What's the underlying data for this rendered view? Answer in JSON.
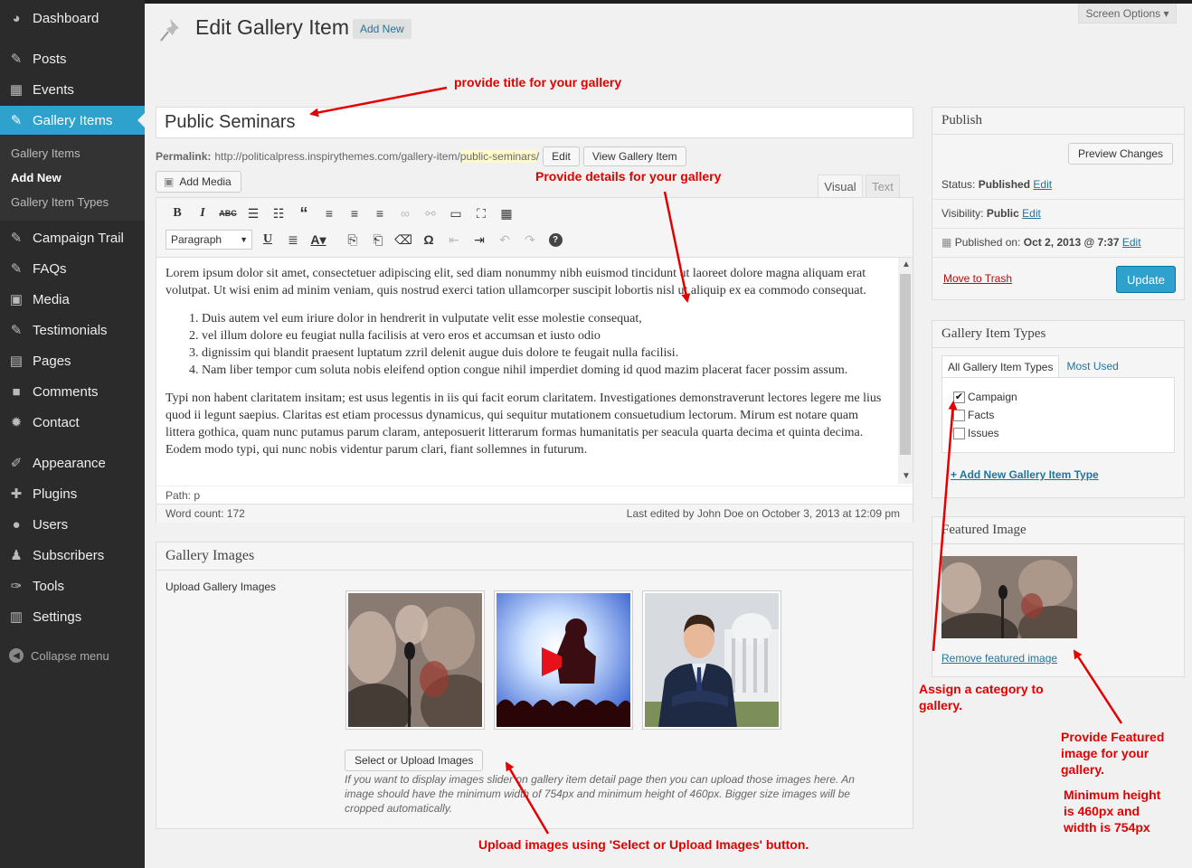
{
  "sidebar": {
    "items": [
      {
        "label": "Dashboard",
        "icon": "dashboard-icon",
        "glyph": "◕"
      },
      {
        "label": "Posts",
        "icon": "pin-icon",
        "glyph": "✎"
      },
      {
        "label": "Events",
        "icon": "calendar-icon",
        "glyph": "▦"
      },
      {
        "label": "Gallery Items",
        "icon": "pin-icon",
        "glyph": "✎"
      },
      {
        "label": "Campaign Trail",
        "icon": "pin-icon",
        "glyph": "✎"
      },
      {
        "label": "FAQs",
        "icon": "pin-icon",
        "glyph": "✎"
      },
      {
        "label": "Media",
        "icon": "media-icon",
        "glyph": "▣"
      },
      {
        "label": "Testimonials",
        "icon": "pin-icon",
        "glyph": "✎"
      },
      {
        "label": "Pages",
        "icon": "pages-icon",
        "glyph": "▤"
      },
      {
        "label": "Comments",
        "icon": "comment-icon",
        "glyph": "■"
      },
      {
        "label": "Contact",
        "icon": "gear-icon",
        "glyph": "✹"
      },
      {
        "label": "Appearance",
        "icon": "brush-icon",
        "glyph": "✐"
      },
      {
        "label": "Plugins",
        "icon": "plugin-icon",
        "glyph": "✚"
      },
      {
        "label": "Users",
        "icon": "user-icon",
        "glyph": "●"
      },
      {
        "label": "Subscribers",
        "icon": "subscriber-icon",
        "glyph": "♟"
      },
      {
        "label": "Tools",
        "icon": "wrench-icon",
        "glyph": "✑"
      },
      {
        "label": "Settings",
        "icon": "settings-icon",
        "glyph": "▥"
      }
    ],
    "submenu": [
      "Gallery Items",
      "Add New",
      "Gallery Item Types"
    ],
    "collapse": "Collapse menu"
  },
  "header": {
    "title": "Edit Gallery Item",
    "add_new": "Add New",
    "screen_options": "Screen Options ▾"
  },
  "post": {
    "title": "Public Seminars",
    "permalink_label": "Permalink:",
    "permalink_base": "http://politicalpress.inspirythemes.com/gallery-item/",
    "permalink_slug": "public-seminars",
    "permalink_end": "/",
    "edit_btn": "Edit",
    "view_btn": "View Gallery Item"
  },
  "editor": {
    "add_media": "Add Media",
    "tab_visual": "Visual",
    "tab_text": "Text",
    "format": "Paragraph",
    "para1": "Lorem ipsum dolor sit amet, consectetuer adipiscing elit, sed diam nonummy nibh euismod tincidunt ut laoreet dolore magna aliquam erat volutpat. Ut wisi enim ad minim veniam, quis nostrud exerci tation ullamcorper suscipit lobortis nisl ut aliquip ex ea commodo consequat.",
    "list": [
      "Duis autem vel eum iriure dolor in hendrerit in vulputate velit esse molestie consequat,",
      "vel illum dolore eu feugiat nulla facilisis at vero eros et accumsan et iusto odio",
      "dignissim qui blandit praesent luptatum zzril delenit augue duis dolore te feugait nulla facilisi.",
      "Nam liber tempor cum soluta nobis eleifend option congue nihil imperdiet doming id quod mazim placerat facer possim assum."
    ],
    "para2": "Typi non habent claritatem insitam; est usus legentis in iis qui facit eorum claritatem. Investigationes demonstraverunt lectores legere me lius quod ii legunt saepius. Claritas est etiam processus dynamicus, qui sequitur mutationem consuetudium lectorum. Mirum est notare quam littera gothica, quam nunc putamus parum claram, anteposuerit litterarum formas humanitatis per seacula quarta decima et quinta decima. Eodem modo typi, qui nunc nobis videntur parum clari, fiant sollemnes in futurum.",
    "path": "Path: p",
    "word_count": "Word count: 172",
    "last_edited": "Last edited by John Doe on October 3, 2013 at 12:09 pm"
  },
  "gallery": {
    "heading": "Gallery Images",
    "label": "Upload Gallery Images",
    "button": "Select or Upload Images",
    "note": "If you want to display images slider on gallery item detail page then you can upload those images here. An image should have the minimum width of 754px and minimum height of 460px. Bigger size images will be cropped automatically."
  },
  "publish": {
    "heading": "Publish",
    "preview": "Preview Changes",
    "status_label": "Status:",
    "status_value": "Published",
    "visibility_label": "Visibility:",
    "visibility_value": "Public",
    "published_label": "Published on:",
    "published_value": "Oct 2, 2013 @ 7:37",
    "edit": "Edit",
    "trash": "Move to Trash",
    "update": "Update"
  },
  "types": {
    "heading": "Gallery Item Types",
    "tab_all": "All Gallery Item Types",
    "tab_used": "Most Used",
    "items": [
      {
        "label": "Campaign",
        "checked": true
      },
      {
        "label": "Facts",
        "checked": false
      },
      {
        "label": "Issues",
        "checked": false
      }
    ],
    "add_new": "+ Add New Gallery Item Type"
  },
  "featured": {
    "heading": "Featured Image",
    "remove": "Remove featured image"
  },
  "annotations": {
    "title_note": "provide title for your gallery",
    "details_note": "Provide details for your gallery",
    "category_note": "Assign a category to gallery.",
    "featured_note": "Provide Featured image for your gallery.",
    "size_note": "Minimum height is 460px and width is 754px",
    "upload_note": "Upload images using 'Select or Upload Images' button."
  },
  "colors": {
    "accent": "#2ea2cc",
    "sidebar": "#2b2b2b",
    "link": "#21759b",
    "annotation": "#e50000"
  }
}
